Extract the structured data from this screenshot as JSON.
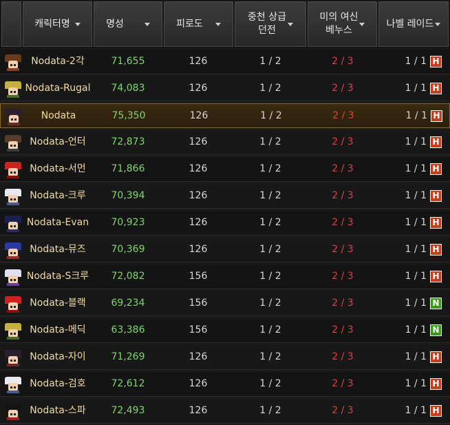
{
  "colors": {
    "fame": "#7ed86b",
    "dungeon2": "#e04040",
    "name": "#f0dba0",
    "badge_hard": "#c0401a",
    "badge_normal": "#3a9a1a",
    "selected_row": "#3a2a12"
  },
  "header": {
    "name": "캐릭터명",
    "fame": "명성",
    "fatigue": "피로도",
    "dungeon1": "중천 상급\n던전",
    "dungeon2": "미의 여신\n베누스",
    "raid": "나벨 레이드"
  },
  "rows": [
    {
      "name": "Nodata-2각",
      "fame": "71,655",
      "fatigue": "126",
      "dungeon1": "1 / 2",
      "dungeon2": "2 / 3",
      "raid": "1 / 1",
      "badge": "H",
      "avatar": "brown-hair-avatar-icon"
    },
    {
      "name": "Nodata-Rugal",
      "fame": "74,083",
      "fatigue": "126",
      "dungeon1": "1 / 2",
      "dungeon2": "2 / 3",
      "raid": "1 / 1",
      "badge": "H",
      "avatar": "blonde-hair-avatar-icon"
    },
    {
      "name": "Nodata",
      "fame": "75,350",
      "fatigue": "126",
      "dungeon1": "1 / 2",
      "dungeon2": "2 / 3",
      "raid": "1 / 1",
      "badge": "H",
      "avatar": "dark-hair-avatar-icon",
      "selected": true
    },
    {
      "name": "Nodata-언터",
      "fame": "72,873",
      "fatigue": "126",
      "dungeon1": "1 / 2",
      "dungeon2": "2 / 3",
      "raid": "1 / 1",
      "badge": "H",
      "avatar": "hat-avatar-icon"
    },
    {
      "name": "Nodata-서먼",
      "fame": "71,866",
      "fatigue": "126",
      "dungeon1": "1 / 2",
      "dungeon2": "2 / 3",
      "raid": "1 / 1",
      "badge": "H",
      "avatar": "red-hair-avatar-icon"
    },
    {
      "name": "Nodata-크루",
      "fame": "70,394",
      "fatigue": "126",
      "dungeon1": "1 / 2",
      "dungeon2": "2 / 3",
      "raid": "1 / 1",
      "badge": "H",
      "avatar": "white-hair-avatar-icon"
    },
    {
      "name": "Nodata-Evan",
      "fame": "70,923",
      "fatigue": "126",
      "dungeon1": "1 / 2",
      "dungeon2": "2 / 3",
      "raid": "1 / 1",
      "badge": "H",
      "avatar": "navy-hair-avatar-icon"
    },
    {
      "name": "Nodata-뮤즈",
      "fame": "70,369",
      "fatigue": "126",
      "dungeon1": "1 / 2",
      "dungeon2": "2 / 3",
      "raid": "1 / 1",
      "badge": "H",
      "avatar": "blue-hair-avatar-icon"
    },
    {
      "name": "Nodata-S크루",
      "fame": "72,082",
      "fatigue": "156",
      "dungeon1": "1 / 2",
      "dungeon2": "2 / 3",
      "raid": "1 / 1",
      "badge": "H",
      "avatar": "white-purple-avatar-icon"
    },
    {
      "name": "Nodata-블랙",
      "fame": "69,234",
      "fatigue": "156",
      "dungeon1": "1 / 2",
      "dungeon2": "2 / 3",
      "raid": "1 / 1",
      "badge": "N",
      "avatar": "red-hair-avatar-icon"
    },
    {
      "name": "Nodata-메딕",
      "fame": "63,386",
      "fatigue": "156",
      "dungeon1": "1 / 2",
      "dungeon2": "2 / 3",
      "raid": "1 / 1",
      "badge": "N",
      "avatar": "blonde-hair-avatar-icon"
    },
    {
      "name": "Nodata-자이",
      "fame": "71,269",
      "fatigue": "126",
      "dungeon1": "1 / 2",
      "dungeon2": "2 / 3",
      "raid": "1 / 1",
      "badge": "H",
      "avatar": "dark-hair-avatar-icon"
    },
    {
      "name": "Nodata-검호",
      "fame": "72,612",
      "fatigue": "126",
      "dungeon1": "1 / 2",
      "dungeon2": "2 / 3",
      "raid": "1 / 1",
      "badge": "H",
      "avatar": "white-hair-avatar-icon"
    },
    {
      "name": "Nodata-스파",
      "fame": "72,493",
      "fatigue": "126",
      "dungeon1": "1 / 2",
      "dungeon2": "2 / 3",
      "raid": "1 / 1",
      "badge": "H",
      "avatar": "black-hair-avatar-icon"
    }
  ]
}
